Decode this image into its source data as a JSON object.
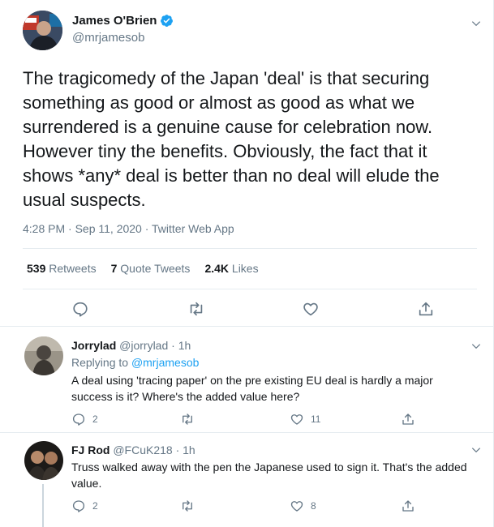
{
  "main_tweet": {
    "author_name": "James O'Brien",
    "author_handle": "@mrjamesob",
    "text": "The tragicomedy of the Japan 'deal' is that securing something as good or almost as good as what we surrendered is a genuine cause for celebration now. However tiny the benefits. Obviously, the fact that it shows *any* deal is better than no deal will elude the usual suspects.",
    "meta": "4:28 PM · Sep 11, 2020 · Twitter Web App",
    "retweets_count": "539",
    "retweets_label": "Retweets",
    "quotes_count": "7",
    "quotes_label": "Quote Tweets",
    "likes_count": "2.4K",
    "likes_label": "Likes"
  },
  "replies": [
    {
      "name": "Jorrylad",
      "handle_time": "@jorrylad · 1h",
      "replying_prefix": "Replying to",
      "replying_handle": "@mrjamesob",
      "text": "A deal using 'tracing paper' on the pre existing EU deal is hardly a major success is it?  Where's the added value here?",
      "reply_count": "2",
      "like_count": "11"
    },
    {
      "name": "FJ Rod",
      "handle_time": "@FCuK218 · 1h",
      "text": "Truss walked away with the pen the Japanese used to sign it. That's the added value.",
      "reply_count": "2",
      "like_count": "8"
    }
  ],
  "colors": {
    "accent": "#1da1f2",
    "secondary_text": "#657786",
    "divider": "#e6ecf0"
  },
  "icons": [
    "verified-icon",
    "chevron-down-icon",
    "reply-icon",
    "retweet-icon",
    "like-icon",
    "share-icon"
  ]
}
